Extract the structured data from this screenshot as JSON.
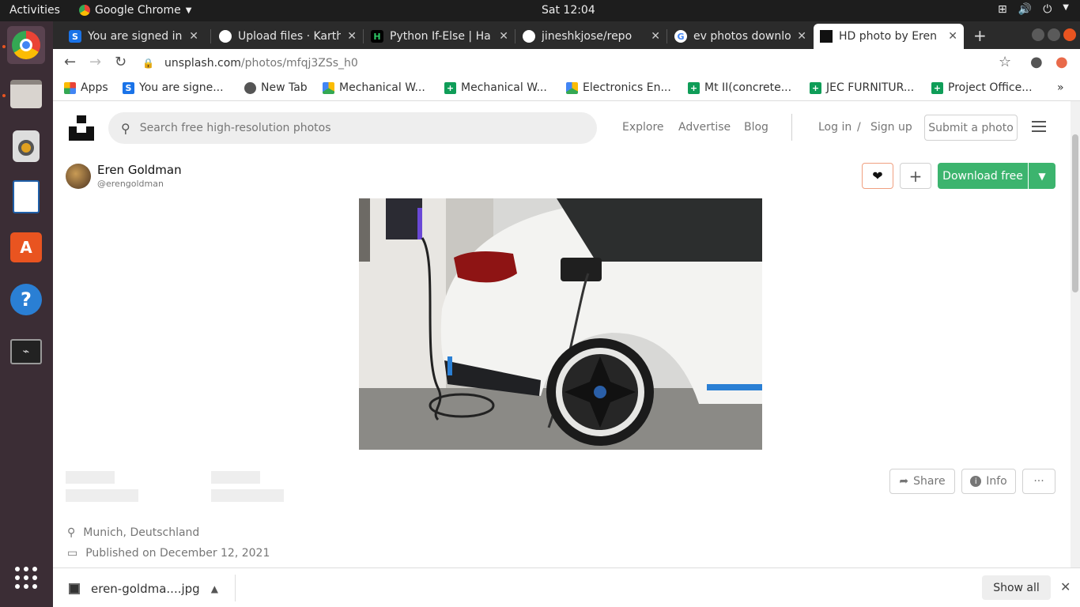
{
  "system": {
    "activities": "Activities",
    "app_name": "Google Chrome",
    "clock": "Sat 12:04"
  },
  "tabs": [
    {
      "title": "You are signed in a",
      "icon": "s-icon",
      "color": "#1a73e8"
    },
    {
      "title": "Upload files · Karth",
      "icon": "github-icon",
      "color": "#ffffff"
    },
    {
      "title": "Python If-Else | Ha",
      "icon": "hackerrank-icon",
      "color": "#2ec866"
    },
    {
      "title": "jineshkjose/repo",
      "icon": "github-icon",
      "color": "#ffffff"
    },
    {
      "title": "ev photos downlo",
      "icon": "google-icon",
      "color": "#4285f4"
    },
    {
      "title": "HD photo by Eren",
      "icon": "unsplash-icon",
      "color": "#111111",
      "active": true
    }
  ],
  "address": {
    "domain": "unsplash.com",
    "path": "/photos/mfqj3ZSs_h0"
  },
  "bookmarks": [
    {
      "label": "Apps",
      "icon": "apps-grid-icon",
      "color": "#e94335"
    },
    {
      "label": "You are signe...",
      "icon": "s-icon",
      "color": "#1a73e8"
    },
    {
      "label": "New Tab",
      "icon": "globe-icon",
      "color": "#555555"
    },
    {
      "label": "Mechanical W...",
      "icon": "drive-icon",
      "color": "#fbbc04"
    },
    {
      "label": "Mechanical W...",
      "icon": "sheets-icon",
      "color": "#0f9d58"
    },
    {
      "label": "Electronics En...",
      "icon": "drive-icon",
      "color": "#fbbc04"
    },
    {
      "label": "Mt II(concrete...",
      "icon": "sheets-icon",
      "color": "#0f9d58"
    },
    {
      "label": "JEC FURNITUR...",
      "icon": "sheets-icon",
      "color": "#0f9d58"
    },
    {
      "label": "Project Office...",
      "icon": "sheets-icon",
      "color": "#0f9d58"
    }
  ],
  "header": {
    "search_placeholder": "Search free high-resolution photos",
    "explore": "Explore",
    "advertise": "Advertise",
    "blog": "Blog",
    "login": "Log in",
    "slash": "/",
    "signup": "Sign up",
    "submit": "Submit a photo"
  },
  "photo": {
    "author_name": "Eren Goldman",
    "author_handle": "@erengoldman",
    "download_label": "Download free",
    "accent": "#3cb46e"
  },
  "actions": {
    "share": "Share",
    "info": "Info",
    "more": "···"
  },
  "meta": {
    "location": "Munich, Deutschland",
    "published": "Published on December 12, 2021"
  },
  "downloads": {
    "file": "eren-goldma....jpg",
    "show_all": "Show all"
  }
}
